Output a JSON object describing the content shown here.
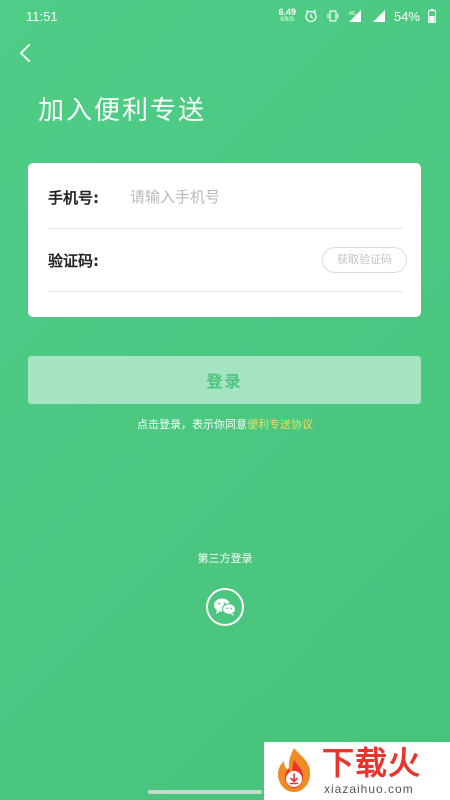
{
  "status_bar": {
    "time": "11:51",
    "net_speed_value": "6.49",
    "net_speed_unit": "KB/S",
    "network_label": "4G",
    "battery": "54%",
    "icons": [
      "alarm-icon",
      "vibrate-icon",
      "signal-icon",
      "battery-icon"
    ]
  },
  "header": {
    "back_icon": "chevron-left-icon",
    "title": "加入便利专送"
  },
  "form": {
    "phone_label": "手机号:",
    "phone_placeholder": "请输入手机号",
    "phone_value": "",
    "code_label": "验证码:",
    "code_value": "",
    "code_button": "获取验证码"
  },
  "login": {
    "button_label": "登录",
    "agreement_prefix": "点击登录，表示你同意",
    "agreement_link": "便利专送协议"
  },
  "third_party": {
    "label": "第三方登录",
    "wechat_icon": "wechat-icon"
  },
  "watermark": {
    "name": "下载火",
    "url": "xiazaihuo.com"
  },
  "colors": {
    "background": "#4fcd86",
    "login_button": "#a5e4c2",
    "agreement_link": "#f5dc5a",
    "watermark_red": "#e9352d"
  }
}
